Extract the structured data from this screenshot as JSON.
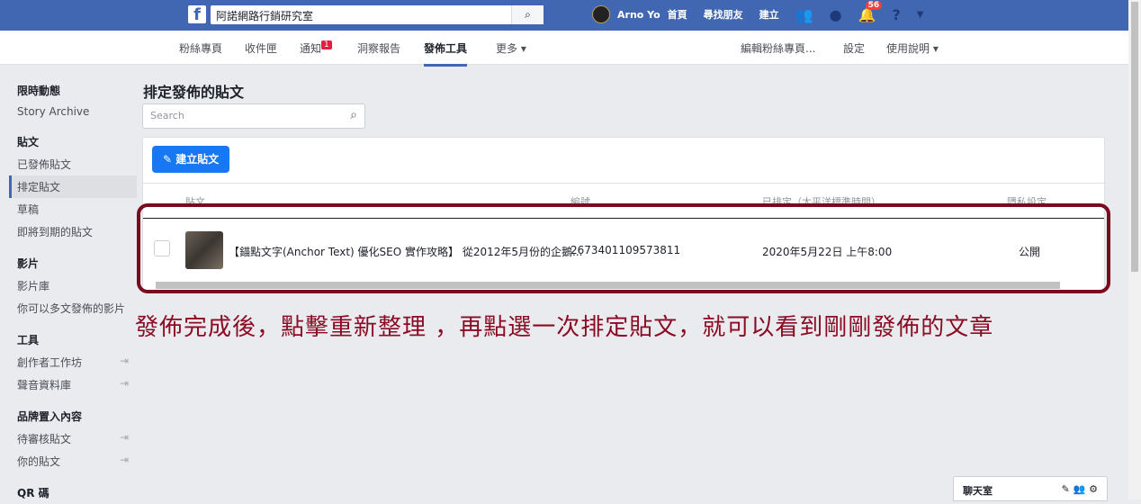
{
  "topbar": {
    "search_value": "阿諾網路行銷研究室",
    "user": "Arno Yo",
    "nav": [
      "首頁",
      "尋找朋友",
      "建立"
    ],
    "notif_count": "56"
  },
  "subnav": {
    "left": [
      "粉絲專頁",
      "收件匣",
      "通知",
      "洞察報告",
      "發佈工具",
      "更多 ▾"
    ],
    "notif_badge": "1",
    "right": [
      "編輯粉絲專頁...",
      "設定",
      "使用說明 ▾"
    ]
  },
  "sidebar": {
    "sections": [
      {
        "heading": "限時動態",
        "items": [
          "Story Archive"
        ]
      },
      {
        "heading": "貼文",
        "items": [
          "已發佈貼文",
          "排定貼文",
          "草稿",
          "即將到期的貼文"
        ]
      },
      {
        "heading": "影片",
        "items": [
          "影片庫",
          "你可以多文發佈的影片"
        ]
      },
      {
        "heading": "工具",
        "items": [
          "創作者工作坊",
          "聲音資料庫"
        ]
      },
      {
        "heading": "品牌置入內容",
        "items": [
          "待審核貼文",
          "你的貼文"
        ]
      },
      {
        "heading": "QR 碼",
        "items": []
      }
    ]
  },
  "main": {
    "title": "排定發佈的貼文",
    "search_placeholder": "Search",
    "create_label": "建立貼文",
    "columns": [
      "貼文",
      "編號",
      "已排定（太平洋標準時間）",
      "隱私設定"
    ],
    "rows": [
      {
        "post": "【錨點文字(Anchor Text) 優化SEO 實作攻略】 從2012年5月份的企鵝...",
        "id": "2673401109573811",
        "scheduled": "2020年5月22日 上午8:00",
        "privacy": "公開"
      }
    ]
  },
  "annotation": "發佈完成後，點擊重新整理 ，再點選一次排定貼文，就可以看到剛剛發佈的文章",
  "chat": {
    "label": "聊天室"
  },
  "colors": {
    "brand": "#4267b2",
    "annotation": "#8b0a24"
  }
}
